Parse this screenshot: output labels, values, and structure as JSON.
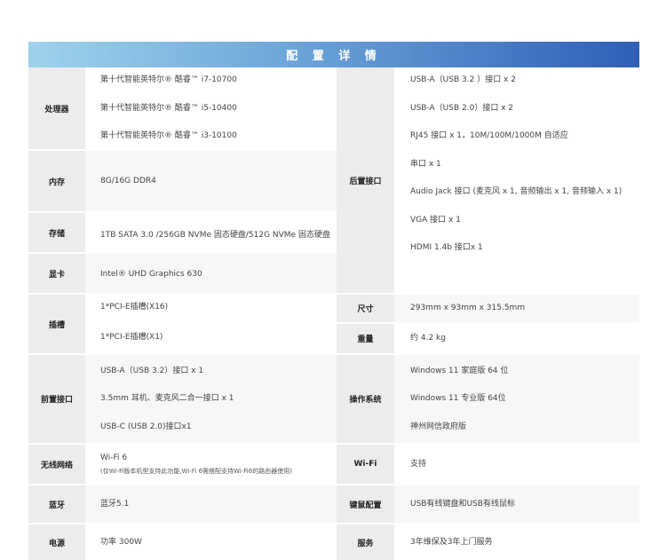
{
  "header": {
    "title": "配 置 详 情"
  },
  "left": {
    "cpu": {
      "label": "处理器",
      "values": [
        "第十代智能英特尔® 酷睿™ i7-10700",
        "第十代智能英特尔® 酷睿™ i5-10400",
        "第十代智能英特尔® 酷睿™ i3-10100"
      ]
    },
    "memory": {
      "label": "内存",
      "value": "8G/16G DDR4"
    },
    "storage": {
      "label": "存储",
      "value": "1TB SATA 3.0 /256GB NVMe 固态硬盘/512G NVMe 固态硬盘"
    },
    "gpu": {
      "label": "显卡",
      "value": "Intel® UHD Graphics 630"
    },
    "slots": {
      "label": "插槽",
      "values": [
        "1*PCI-E插槽(X16)",
        "1*PCI-E插槽(X1)"
      ]
    },
    "front_ports": {
      "label": "前置接口",
      "values": [
        "USB-A（USB 3.2）接口 x 1",
        "3.5mm 耳机、麦克风二合一接口 x 1",
        "USB-C (USB 2.0)接口x1"
      ]
    },
    "wireless": {
      "label": "无线网络",
      "value": "Wi-Fi 6",
      "note": "(仅Wi-Fi版本机型支持此功能,Wi-Fi 6需搭配支持Wi-Fi6的路由器使用)"
    },
    "bluetooth": {
      "label": "蓝牙",
      "value": "蓝牙5.1"
    },
    "power": {
      "label": "电源",
      "value": "功率 300W"
    }
  },
  "right": {
    "rear_ports": {
      "label": "后置接口",
      "values": [
        "USB-A（USB 3.2 ）接口 x 2",
        "USB-A（USB 2.0）接口 x 2",
        "RJ45 接口 x 1，10M/100M/1000M 自适应",
        "串口 x 1",
        "Audio Jack 接口 (麦克风 x 1, 音频输出 x 1, 音频输入 x 1)",
        "VGA 接口 x 1",
        "HDMI 1.4b 接口x 1"
      ]
    },
    "size": {
      "label": "尺寸",
      "value": "293mm x 93mm x 315.5mm"
    },
    "weight": {
      "label": "重量",
      "value": "约 4.2 kg"
    },
    "os": {
      "label": "操作系统",
      "values": [
        "Windows 11 家庭版 64 位",
        "Windows 11 专业版 64位",
        "神州网信政府版"
      ]
    },
    "wifi": {
      "label": "Wi-Fi",
      "value": "支持"
    },
    "peripherals": {
      "label": "键鼠配置",
      "value": "USB有线键盘和USB有线鼠标"
    },
    "service": {
      "label": "服务",
      "value": "3年维保及3年上门服务"
    }
  }
}
